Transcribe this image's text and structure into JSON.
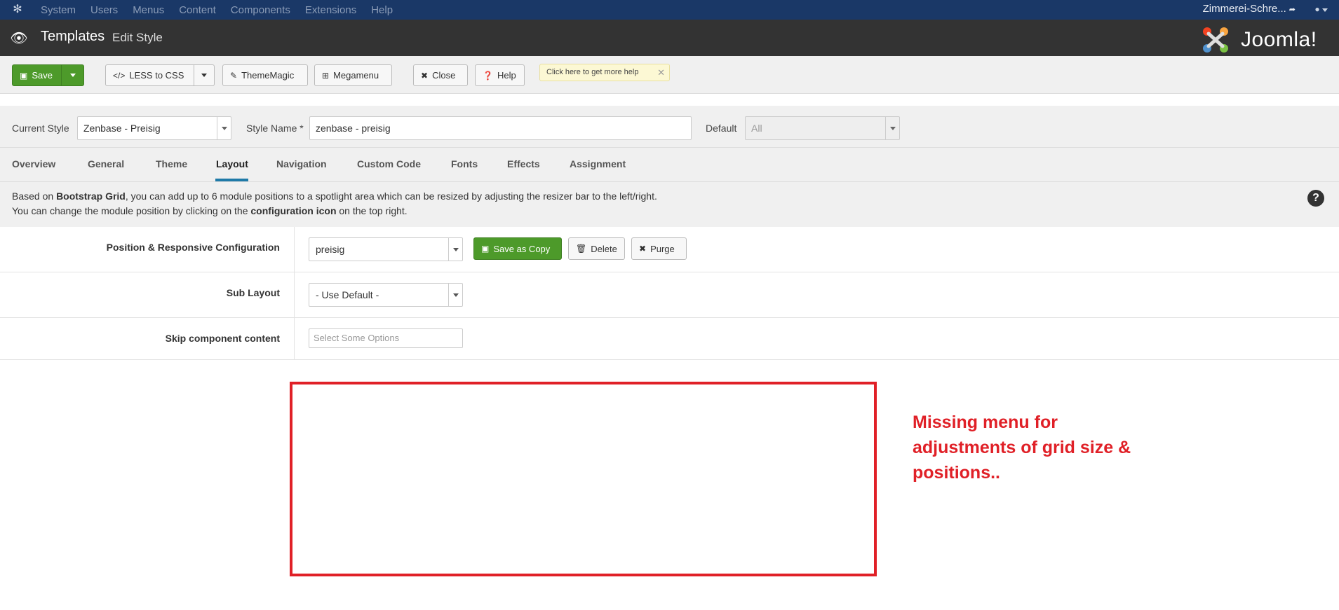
{
  "topnav": {
    "menu": [
      "System",
      "Users",
      "Menus",
      "Content",
      "Components",
      "Extensions",
      "Help"
    ],
    "site_name": "Zimmerei-Schre...",
    "user_icon": "user-icon"
  },
  "titlebar": {
    "title": "Templates",
    "subtitle": "Edit Style",
    "brand": "Joomla!"
  },
  "toolbar": {
    "save": "Save",
    "less_to_css": "LESS to CSS",
    "theme_magic": "ThemeMagic",
    "megamenu": "Megamenu",
    "close": "Close",
    "help": "Help",
    "tip": "Click here to get more help"
  },
  "style": {
    "current_style_label": "Current Style",
    "current_style_value": "Zenbase - Preisig",
    "style_name_label": "Style Name *",
    "style_name_value": "zenbase - preisig",
    "default_label": "Default",
    "default_value": "All"
  },
  "tabs": [
    "Overview",
    "General",
    "Theme",
    "Layout",
    "Navigation",
    "Custom Code",
    "Fonts",
    "Effects",
    "Assignment"
  ],
  "info": {
    "line1_pre": "Based on ",
    "line1_bold": "Bootstrap Grid",
    "line1_post": ", you can add up to 6 module positions to a spotlight area which can be resized by adjusting the resizer bar to the left/right.",
    "line2_pre": "You can change the module position by clicking on the ",
    "line2_bold": "configuration icon",
    "line2_post": " on the top right."
  },
  "form": {
    "position_label": "Position & Responsive Configuration",
    "position_value": "preisig",
    "save_as_copy": "Save as Copy",
    "delete": "Delete",
    "purge": "Purge",
    "sublayout_label": "Sub Layout",
    "sublayout_value": "- Use Default -",
    "skip_label": "Skip component content",
    "skip_placeholder": "Select Some Options"
  },
  "annotation": "Missing menu for adjustments of grid size & positions..",
  "colors": {
    "accent_green": "#4d9a2a",
    "annotation_red": "#e02027",
    "nav_blue": "#1a3867",
    "tab_active": "#1f7aa8"
  }
}
